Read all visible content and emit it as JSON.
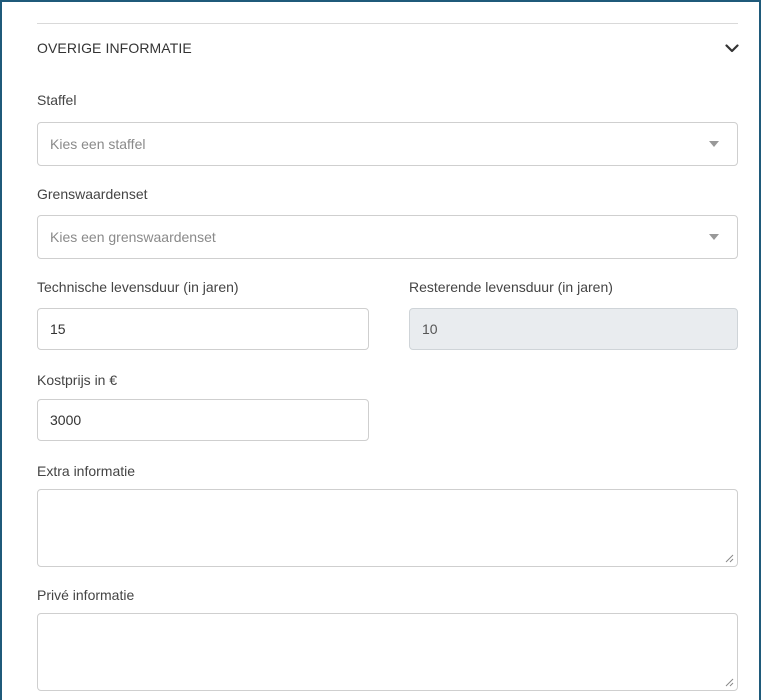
{
  "section": {
    "title": "OVERIGE INFORMATIE",
    "toggle_icon": "chevron-down-icon"
  },
  "staffel": {
    "label": "Staffel",
    "placeholder": "Kies een staffel",
    "dropdown_icon": "caret-down-icon"
  },
  "grenswaardenset": {
    "label": "Grenswaardenset",
    "placeholder": "Kies een grenswaardenset",
    "dropdown_icon": "caret-down-icon"
  },
  "technische_levensduur": {
    "label": "Technische levensduur (in jaren)",
    "value": "15"
  },
  "resterende_levensduur": {
    "label": "Resterende levensduur (in jaren)",
    "value": "10"
  },
  "kostprijs": {
    "label": "Kostprijs in €",
    "value": "3000"
  },
  "extra_informatie": {
    "label": "Extra informatie",
    "value": ""
  },
  "prive_informatie": {
    "label": "Privé informatie",
    "value": ""
  },
  "colors": {
    "frame_border": "#1f5a7a",
    "input_border": "#cfcfcf",
    "readonly_bg": "#e9ecef"
  }
}
